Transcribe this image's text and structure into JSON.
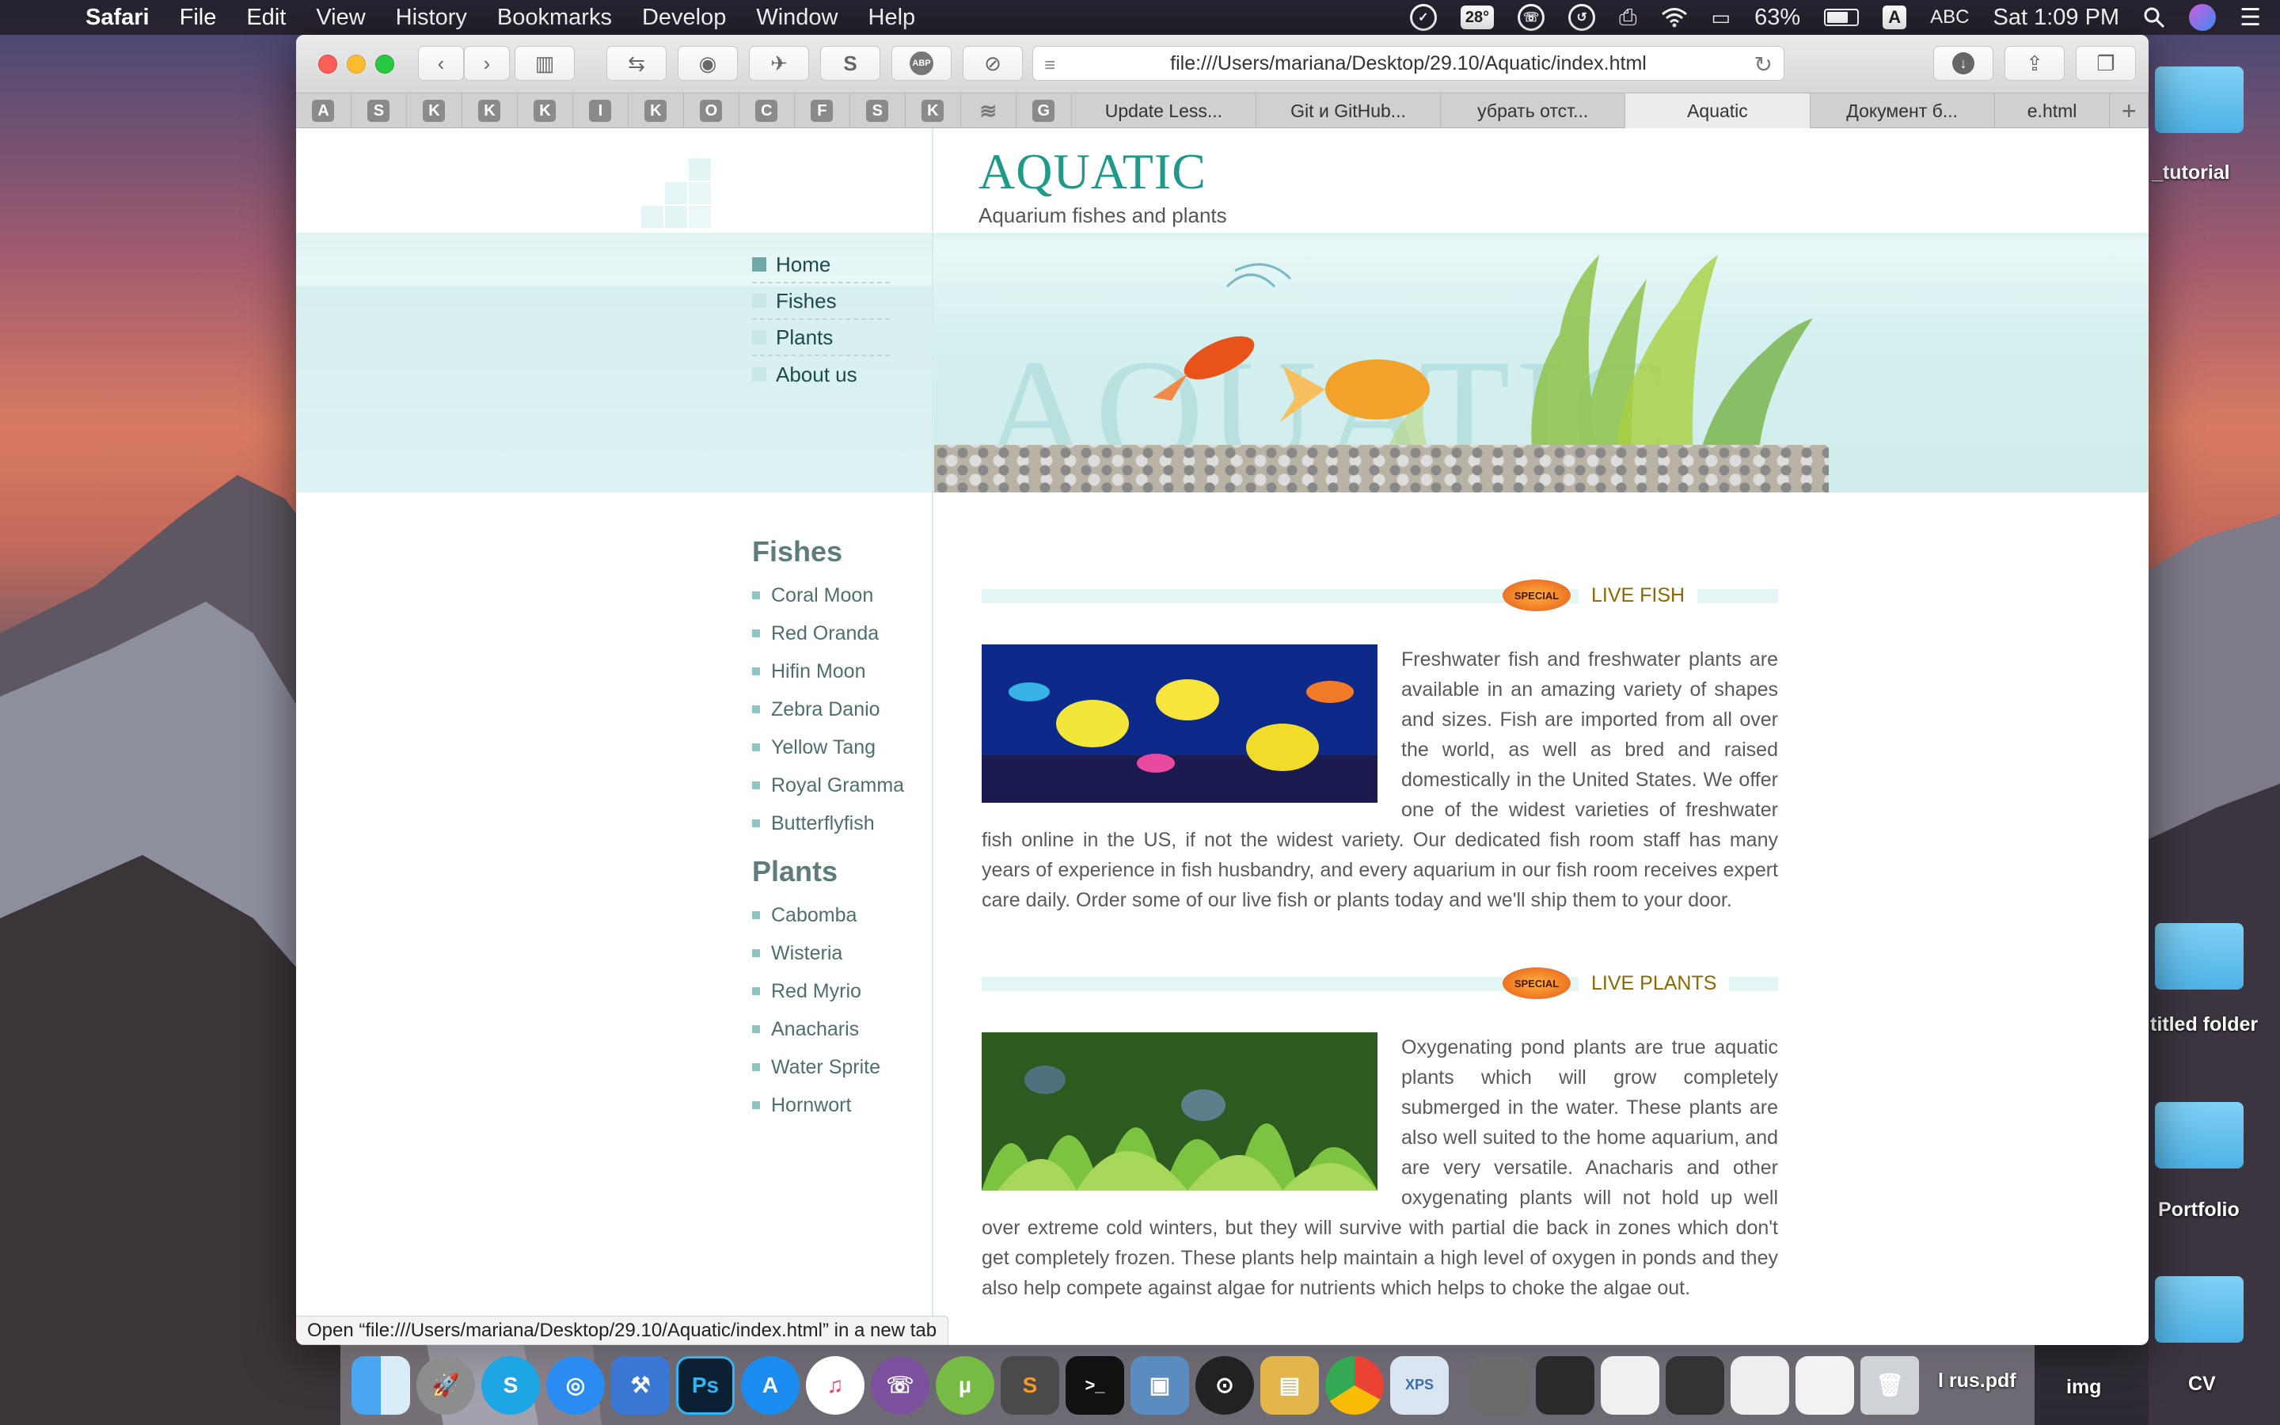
{
  "menubar": {
    "app": "Safari",
    "items": [
      "File",
      "Edit",
      "View",
      "History",
      "Bookmarks",
      "Develop",
      "Window",
      "Help"
    ],
    "temperature": "28°",
    "battery": "63%",
    "input_source": "A",
    "input_label": "ABC",
    "clock": "Sat 1:09 PM"
  },
  "browser": {
    "url": "file:///Users/mariana/Desktop/29.10/Aquatic/index.html",
    "pinned_tabs": [
      "A",
      "S",
      "K",
      "K",
      "K",
      "I",
      "K",
      "O",
      "C",
      "F",
      "S",
      "K",
      "≋",
      "G"
    ],
    "tabs": [
      {
        "title": "Update Less...",
        "active": false
      },
      {
        "title": "Git и GitHub...",
        "active": false
      },
      {
        "title": "убрать отст...",
        "active": false
      },
      {
        "title": "Aquatic",
        "active": true
      },
      {
        "title": "Документ б...",
        "active": false
      },
      {
        "title": "e.html",
        "active": false
      }
    ],
    "new_tab": "+",
    "status": "Open “file:///Users/mariana/Desktop/29.10/Aquatic/index.html” in a new tab"
  },
  "site": {
    "logo": "AQUATIC",
    "tagline": "Aquarium fishes and plants",
    "hero_watermark": "AQUATIC",
    "nav": [
      "Home",
      "Fishes",
      "Plants",
      "About us"
    ],
    "sidebar": {
      "fishes_title": "Fishes",
      "fishes": [
        "Coral Moon",
        "Red Oranda",
        "Hifin Moon",
        "Zebra Danio",
        "Yellow Tang",
        "Royal Gramma",
        "Butterflyfish"
      ],
      "plants_title": "Plants",
      "plants": [
        "Cabomba",
        "Wisteria",
        "Red Myrio",
        "Anacharis",
        "Water Sprite",
        "Hornwort"
      ]
    },
    "badge": "SPECIAL",
    "sections": [
      {
        "title": "LIVE FISH",
        "text": "Freshwater fish and freshwater plants are available in an amazing variety of shapes and sizes. Fish are imported from all over the world, as well as bred and raised domestically in the United States. We offer one of the widest varieties of freshwater fish online in the US, if not the widest variety. Our dedicated fish room staff has many years of experience in fish husbandry, and every aquarium in our fish room receives expert care daily. Order some of our live fish or plants today and we'll ship them to your door."
      },
      {
        "title": "LIVE PLANTS",
        "text": "Oxygenating pond plants are true aquatic plants which will grow completely submerged in the water. These plants are also well suited to the home aquarium, and are very versatile. Anacharis and other oxygenating plants will not hold up well over extreme cold winters, but they will survive with partial die back in zones which don't get completely frozen. These plants help maintain a high level of oxygen in ponds and they also help compete against algae for nutrients which helps to choke the algae out."
      }
    ]
  },
  "desktop": {
    "labels": [
      "_tutorial",
      "titled folder",
      "Portfolio",
      "l rus.pdf",
      "img",
      "CV"
    ]
  }
}
